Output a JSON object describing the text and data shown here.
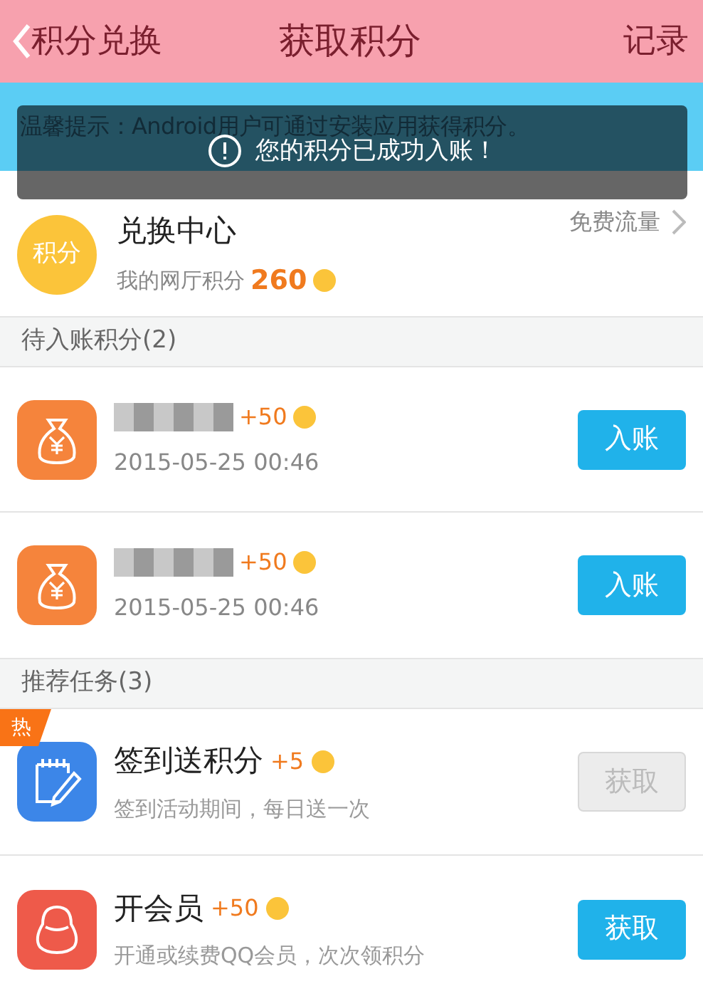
{
  "header": {
    "back_label": "积分兑换",
    "title": "获取积分",
    "action": "记录"
  },
  "notice": "温馨提示：Android用户可通过安装应用获得积分。",
  "toast": "您的积分已成功入账！",
  "exchange": {
    "badge": "积分",
    "title": "兑换中心",
    "points_label": "我的网厅积分",
    "points": "260",
    "link": "免费流量"
  },
  "pending": {
    "title": "待入账积分(2)",
    "items": [
      {
        "name_redacted": true,
        "reward": "+50",
        "time": "2015-05-25 00:46",
        "button": "入账",
        "enabled": true
      },
      {
        "name_redacted": true,
        "reward": "+50",
        "time": "2015-05-25 00:46",
        "button": "入账",
        "enabled": true
      }
    ]
  },
  "tasks": {
    "title": "推荐任务(3)",
    "items": [
      {
        "kind": "checkin",
        "hot": "热",
        "title": "签到送积分",
        "reward": "+5",
        "desc": "签到活动期间，每日送一次",
        "button": "获取",
        "enabled": false
      },
      {
        "kind": "member",
        "title": "开会员",
        "reward": "+50",
        "desc": "开通或续费QQ会员，次次领积分",
        "button": "获取",
        "enabled": true
      }
    ]
  }
}
